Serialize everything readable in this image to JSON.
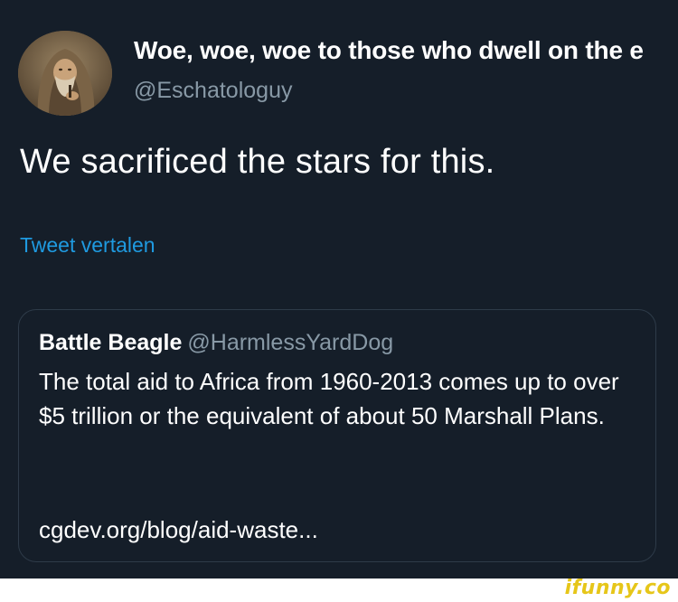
{
  "tweet": {
    "author": {
      "display_name": "Woe, woe, woe to those who dwell on the e",
      "handle": "@Eschatologuy",
      "avatar_icon": "monk-portrait-avatar"
    },
    "text": "We sacrificed the stars for this.",
    "translate_label": "Tweet vertalen"
  },
  "quoted_tweet": {
    "display_name": "Battle Beagle",
    "handle": "@HarmlessYardDog",
    "body": "The total aid to Africa from 1960-2013 comes up to over $5 trillion or the equivalent of about 50 Marshall Plans.",
    "link_text": "cgdev.org/blog/aid-waste..."
  },
  "watermark": {
    "text": "ifunny.co"
  },
  "colors": {
    "background": "#151e29",
    "primary_text": "#ffffff",
    "secondary_text": "#8899a6",
    "link": "#1f9ae0",
    "card_border": "#2e3b49",
    "watermark": "#e6c619"
  }
}
